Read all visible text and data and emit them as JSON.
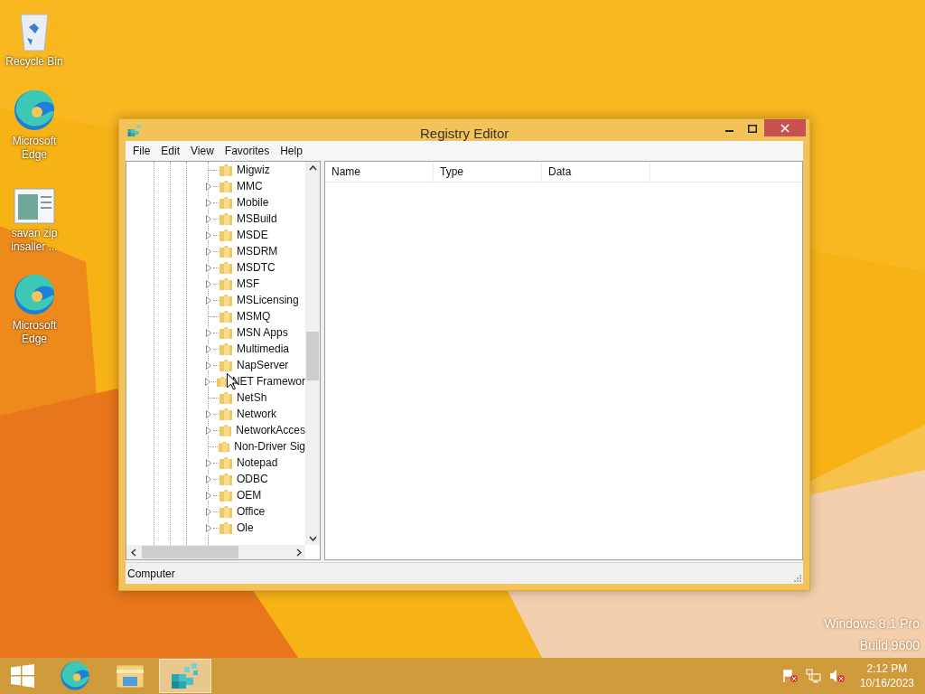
{
  "desktop_icons": [
    {
      "kind": "recycle",
      "label": "Recycle Bin"
    },
    {
      "kind": "edge",
      "label": "Microsoft Edge"
    },
    {
      "kind": "app",
      "label": "savan zip insaller ..."
    },
    {
      "kind": "edge",
      "label": "Microsoft Edge"
    }
  ],
  "window": {
    "title": "Registry Editor",
    "menu": [
      "File",
      "Edit",
      "View",
      "Favorites",
      "Help"
    ],
    "tree": [
      {
        "label": "Migwiz",
        "has_children": false
      },
      {
        "label": "MMC",
        "has_children": true
      },
      {
        "label": "Mobile",
        "has_children": true
      },
      {
        "label": "MSBuild",
        "has_children": true
      },
      {
        "label": "MSDE",
        "has_children": true
      },
      {
        "label": "MSDRM",
        "has_children": true
      },
      {
        "label": "MSDTC",
        "has_children": true
      },
      {
        "label": "MSF",
        "has_children": true
      },
      {
        "label": "MSLicensing",
        "has_children": true
      },
      {
        "label": "MSMQ",
        "has_children": false
      },
      {
        "label": "MSN Apps",
        "has_children": true
      },
      {
        "label": "Multimedia",
        "has_children": true
      },
      {
        "label": "NapServer",
        "has_children": true
      },
      {
        "label": "NET Framewor",
        "has_children": true
      },
      {
        "label": "NetSh",
        "has_children": false
      },
      {
        "label": "Network",
        "has_children": true
      },
      {
        "label": "NetworkAcces",
        "has_children": true
      },
      {
        "label": "Non-Driver Sig",
        "has_children": false
      },
      {
        "label": "Notepad",
        "has_children": true
      },
      {
        "label": "ODBC",
        "has_children": true
      },
      {
        "label": "OEM",
        "has_children": true
      },
      {
        "label": "Office",
        "has_children": true
      },
      {
        "label": "Ole",
        "has_children": true
      }
    ],
    "columns": [
      "Name",
      "Type",
      "Data"
    ],
    "status_bar": "Computer"
  },
  "watermark_lines": [
    "Windows 8.1 Pro",
    "Build 9600"
  ],
  "taskbar": {
    "apps": [
      {
        "kind": "edge",
        "selected": false
      },
      {
        "kind": "explorer",
        "selected": false
      },
      {
        "kind": "regedit",
        "selected": true
      }
    ],
    "time": "2:12 PM",
    "date": "10/16/2023"
  }
}
